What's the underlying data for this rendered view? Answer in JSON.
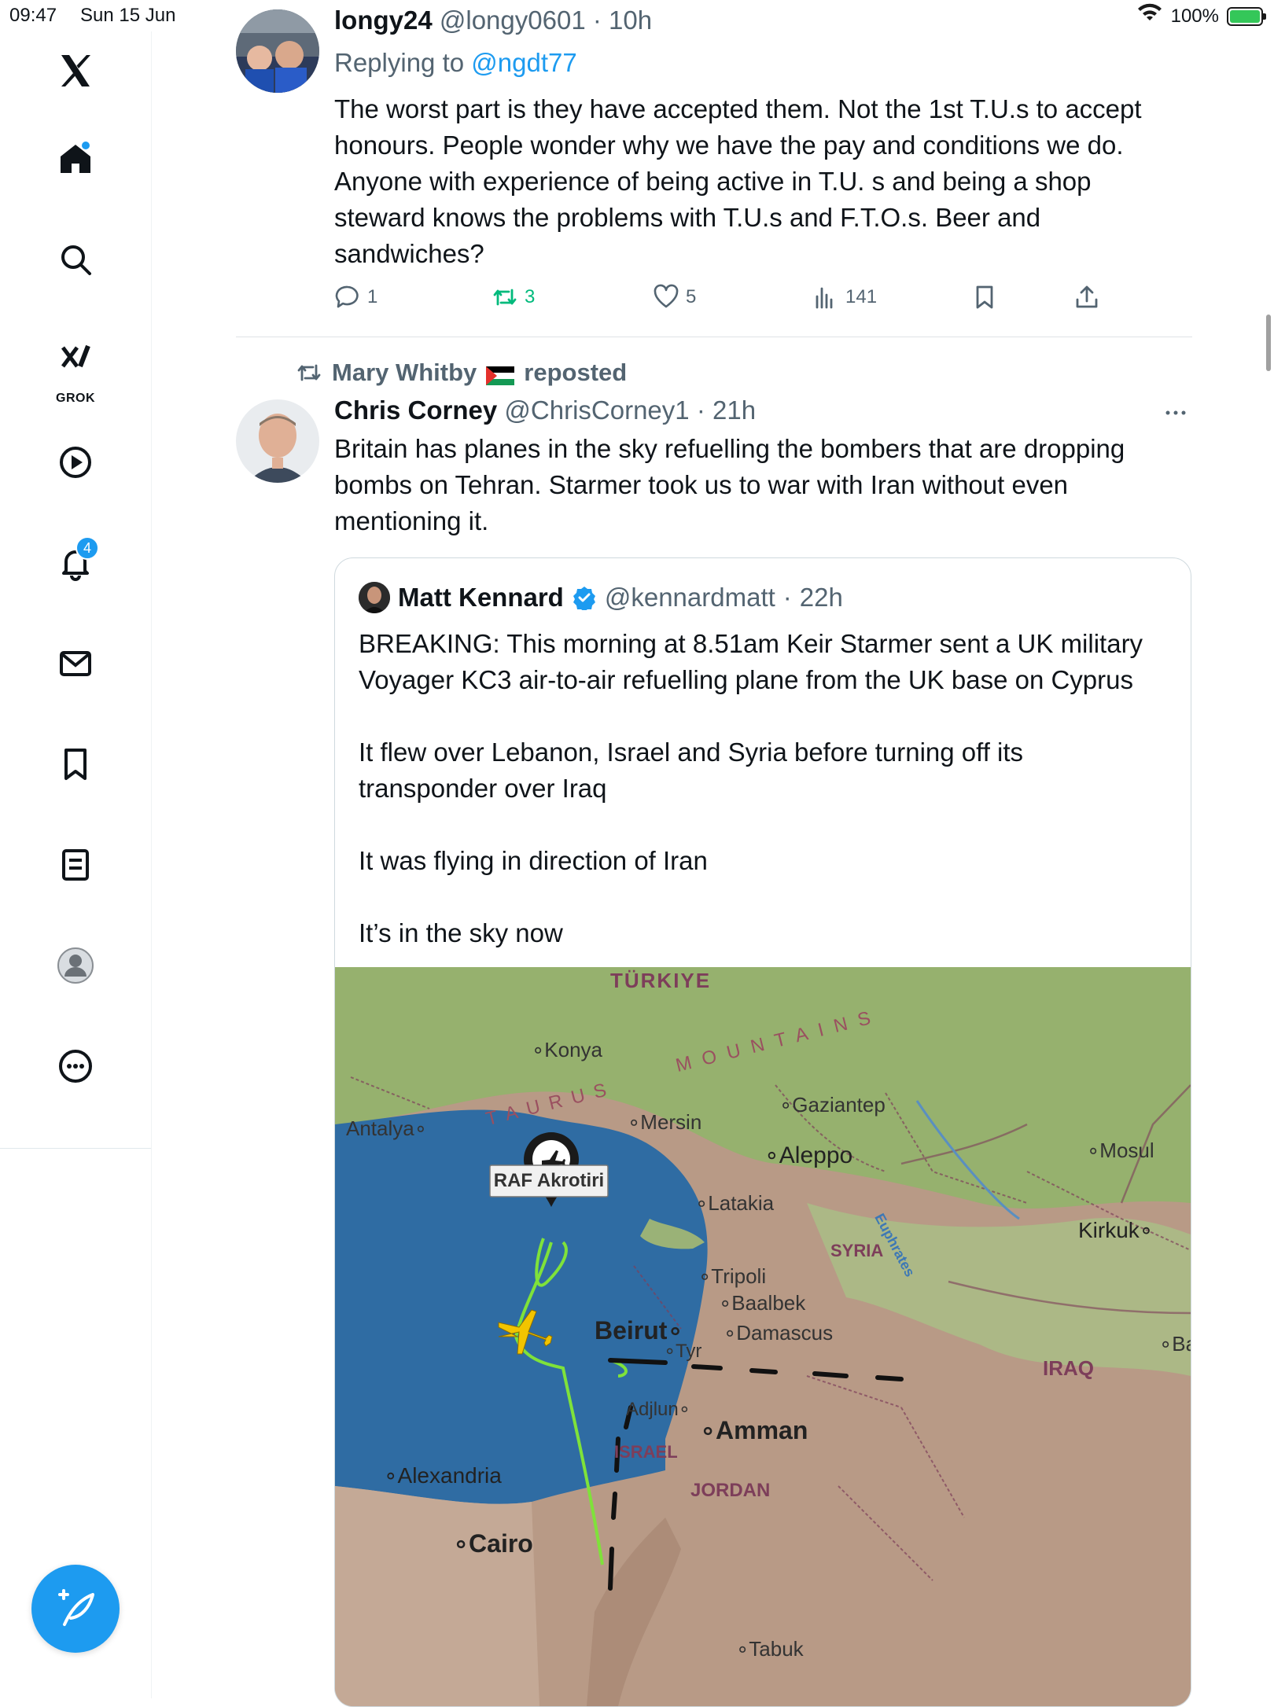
{
  "status_bar": {
    "time": "09:47",
    "date": "Sun 15 Jun",
    "battery": "100%"
  },
  "sidebar": {
    "grok_label": "GROK",
    "notifications_badge": "4"
  },
  "tweet1": {
    "name": "longy24",
    "handle": "@longy0601",
    "time": "10h",
    "replying_label": "Replying to",
    "replying_to": "@ngdt77",
    "text": "The worst part is they have accepted them. Not the 1st T.U.s to accept honours. People wonder why we have the pay and conditions we do. Anyone with experience of being active in T.U. s and being a shop steward knows the problems with T.U.s and F.T.O.s. Beer and sandwiches?",
    "replies": "1",
    "reposts": "3",
    "likes": "5",
    "views": "141"
  },
  "tweet2": {
    "repost_by": "Mary Whitby",
    "repost_label": "reposted",
    "name": "Chris Corney",
    "handle": "@ChrisCorney1",
    "time": "21h",
    "text": "Britain has planes in the sky refuelling the bombers that are dropping bombs on Tehran.  Starmer took us to war with Iran without even mentioning it."
  },
  "quote": {
    "name": "Matt Kennard",
    "handle": "@kennardmatt",
    "time": "22h",
    "paragraphs": [
      "BREAKING: This morning at 8.51am Keir Starmer sent a UK military Voyager KC3 air-to-air refuelling plane from the UK base on Cyprus",
      "It flew over Lebanon, Israel and Syria before turning off its transponder over Iraq",
      "It was flying in direction of Iran",
      "It’s in the sky now"
    ]
  },
  "map": {
    "marker_label": "RAF Akrotiri",
    "countries": [
      "TÜRKIYE",
      "SYRIA",
      "IRAQ",
      "ISRAEL",
      "JORDAN"
    ],
    "mountains": [
      "TAURUS",
      "MOUNTAINS"
    ],
    "river": "Euphrates",
    "cities": [
      "Konya",
      "Antalya",
      "Mersin",
      "Gaziantep",
      "Aleppo",
      "Mosul",
      "Latakia",
      "Kirkuk",
      "Tripoli",
      "Baalbek",
      "Beirut",
      "Damascus",
      "Tyr",
      "Ba",
      "Adjlun",
      "Amman",
      "Alexandria",
      "Cairo",
      "Tabuk"
    ],
    "colors": {
      "sea": "#2f6ca3",
      "land": "#b89a86",
      "green": "#8fb56a",
      "route": "#7fe23a",
      "plane": "#f2c400",
      "border": "#7d3e5a"
    }
  }
}
